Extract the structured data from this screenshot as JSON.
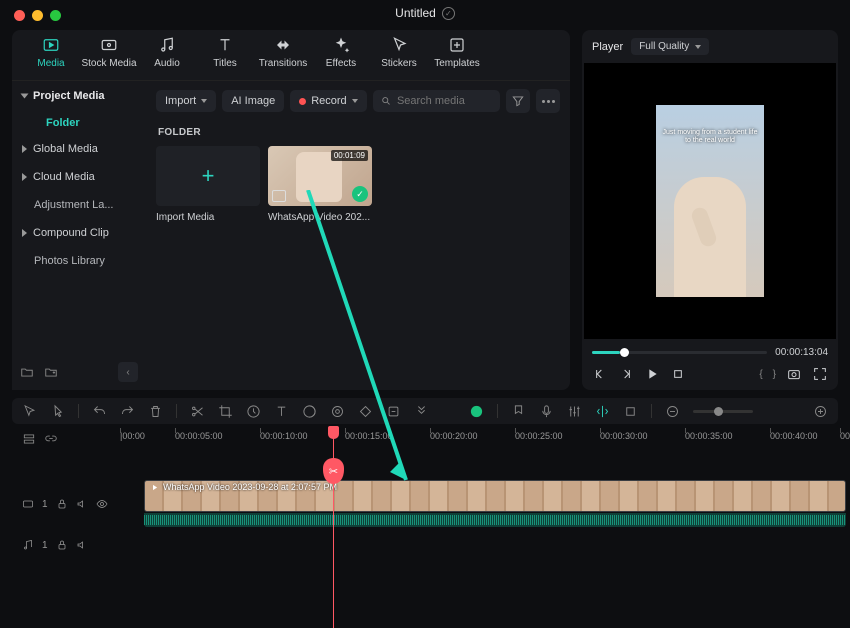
{
  "window": {
    "title": "Untitled"
  },
  "tabs": [
    {
      "label": "Media",
      "icon": "media",
      "active": true
    },
    {
      "label": "Stock Media",
      "icon": "stock"
    },
    {
      "label": "Audio",
      "icon": "audio"
    },
    {
      "label": "Titles",
      "icon": "titles"
    },
    {
      "label": "Transitions",
      "icon": "transitions"
    },
    {
      "label": "Effects",
      "icon": "effects"
    },
    {
      "label": "Stickers",
      "icon": "stickers"
    },
    {
      "label": "Templates",
      "icon": "templates"
    }
  ],
  "sidebar": {
    "header": "Project Media",
    "active_folder": "Folder",
    "items": [
      {
        "label": "Global Media"
      },
      {
        "label": "Cloud Media"
      },
      {
        "label": "Adjustment La..."
      },
      {
        "label": "Compound Clip"
      },
      {
        "label": "Photos Library"
      }
    ]
  },
  "toolbar": {
    "import_label": "Import",
    "ai_image_label": "AI Image",
    "record_label": "Record",
    "search_placeholder": "Search media"
  },
  "content": {
    "section_label": "FOLDER",
    "thumbs": [
      {
        "label": "Import Media",
        "kind": "add"
      },
      {
        "label": "WhatsApp Video 202...",
        "kind": "video",
        "duration": "00:01:09"
      }
    ]
  },
  "player": {
    "title": "Player",
    "quality": "Full Quality",
    "timecode": "00:00:13:04",
    "caption": "Just moving from a student life to the real world"
  },
  "timeline": {
    "ticks": [
      "|00:00",
      "00:00:05:00",
      "00:00:10:00",
      "00:00:15:00",
      "00:00:20:00",
      "00:00:25:00",
      "00:00:30:00",
      "00:00:35:00",
      "00:00:40:00",
      "00:0"
    ],
    "tracks": {
      "video1": {
        "id": "1",
        "clip_label": "WhatsApp Video 2023-09-28 at 2:07:57 PM"
      },
      "audio1": {
        "id": "1"
      }
    }
  }
}
